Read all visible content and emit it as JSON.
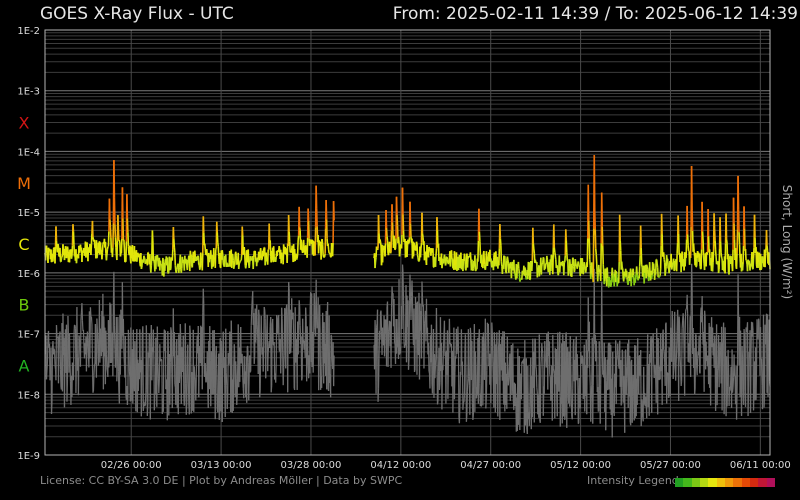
{
  "header": {
    "title": "GOES X-Ray Flux - UTC",
    "range_label": "From: 2025-02-11 14:39  /  To: 2025-06-12 14:39"
  },
  "footer": {
    "license": "License: CC BY-SA 3.0 DE | Plot by Andreas Möller | Data by SWPC",
    "legend_label": "Intensity Legend"
  },
  "legend_colors": [
    "#22a022",
    "#44b81c",
    "#7cc816",
    "#b4d812",
    "#e6e60e",
    "#f0c00c",
    "#f09a0a",
    "#ec7208",
    "#e44a06",
    "#d42a10",
    "#c01636",
    "#b0105a"
  ],
  "chart_data": {
    "type": "line",
    "title": "GOES X-Ray Flux - UTC",
    "ylabel": "Short, Long (W/m²)",
    "yscale": "log",
    "ylim": [
      1e-09,
      0.01
    ],
    "y_ticks": [
      "1E-9",
      "1E-8",
      "1E-7",
      "1E-6",
      "1E-5",
      "1E-4",
      "1E-3",
      "1E-2"
    ],
    "xlim": [
      "2025-02-11 14:39",
      "2025-06-12 14:39"
    ],
    "x_ticks": [
      {
        "date": "2025-02-26 00:00",
        "label": "02/26 00:00"
      },
      {
        "date": "2025-03-13 00:00",
        "label": "03/13 00:00"
      },
      {
        "date": "2025-03-28 00:00",
        "label": "03/28 00:00"
      },
      {
        "date": "2025-04-12 00:00",
        "label": "04/12 00:00"
      },
      {
        "date": "2025-04-27 00:00",
        "label": "04/27 00:00"
      },
      {
        "date": "2025-05-12 00:00",
        "label": "05/12 00:00"
      },
      {
        "date": "2025-05-27 00:00",
        "label": "05/27 00:00"
      },
      {
        "date": "2025-06-11 00:00",
        "label": "06/11 00:00"
      }
    ],
    "flare_classes": [
      {
        "label": "A",
        "flux": 3e-08,
        "color": "#22b422"
      },
      {
        "label": "B",
        "flux": 3e-07,
        "color": "#6cc80c"
      },
      {
        "label": "C",
        "flux": 3e-06,
        "color": "#e6e60a"
      },
      {
        "label": "M",
        "flux": 3e-05,
        "color": "#ee6e08"
      },
      {
        "label": "X",
        "flux": 0.0003,
        "color": "#d21414"
      }
    ],
    "grid": true,
    "series": [
      {
        "key": "long",
        "baseline": [
          [
            "2025-02-11 14:39",
            1.8e-06
          ],
          [
            "2025-02-16 00:00",
            2e-06
          ],
          [
            "2025-02-21 00:00",
            2.4e-06
          ],
          [
            "2025-02-26 00:00",
            1.9e-06
          ],
          [
            "2025-03-03 00:00",
            1.2e-06
          ],
          [
            "2025-03-08 00:00",
            1.5e-06
          ],
          [
            "2025-03-13 00:00",
            1.7e-06
          ],
          [
            "2025-03-18 00:00",
            1.6e-06
          ],
          [
            "2025-03-23 00:00",
            1.9e-06
          ],
          [
            "2025-03-28 00:00",
            2.6e-06
          ],
          [
            "2025-04-02 00:00",
            1.9e-06
          ],
          [
            "2025-04-07 00:00",
            1.6e-06
          ],
          [
            "2025-04-12 00:00",
            2.6e-06
          ],
          [
            "2025-04-17 00:00",
            1.8e-06
          ],
          [
            "2025-04-22 00:00",
            1.5e-06
          ],
          [
            "2025-04-27 00:00",
            1.6e-06
          ],
          [
            "2025-05-02 00:00",
            1e-06
          ],
          [
            "2025-05-07 00:00",
            1.3e-06
          ],
          [
            "2025-05-12 00:00",
            1.2e-06
          ],
          [
            "2025-05-17 00:00",
            8e-07
          ],
          [
            "2025-05-22 00:00",
            8.5e-07
          ],
          [
            "2025-05-27 00:00",
            1.4e-06
          ],
          [
            "2025-06-01 00:00",
            1.6e-06
          ],
          [
            "2025-06-06 00:00",
            1.3e-06
          ],
          [
            "2025-06-12 14:39",
            1.6e-06
          ]
        ],
        "flares": [
          [
            "2025-02-13 10:00",
            7e-06
          ],
          [
            "2025-02-16 06:00",
            8e-06
          ],
          [
            "2025-02-19 12:00",
            9e-06
          ],
          [
            "2025-02-22 08:00",
            2.5e-05
          ],
          [
            "2025-02-23 02:00",
            0.00015
          ],
          [
            "2025-02-23 18:00",
            1.1e-05
          ],
          [
            "2025-02-24 12:00",
            4e-05
          ],
          [
            "2025-02-25 06:00",
            3e-05
          ],
          [
            "2025-03-01 12:00",
            6e-06
          ],
          [
            "2025-03-05 00:00",
            8e-06
          ],
          [
            "2025-03-10 00:00",
            1.1e-05
          ],
          [
            "2025-03-12 06:00",
            9e-06
          ],
          [
            "2025-03-16 12:00",
            8e-06
          ],
          [
            "2025-03-21 00:00",
            9e-06
          ],
          [
            "2025-03-24 06:00",
            1.3e-05
          ],
          [
            "2025-03-26 00:00",
            1.6e-05
          ],
          [
            "2025-03-27 12:00",
            1.6e-05
          ],
          [
            "2025-03-28 20:00",
            4.5e-05
          ],
          [
            "2025-03-30 12:00",
            2.4e-05
          ],
          [
            "2025-03-31 18:00",
            2.2e-05
          ],
          [
            "2025-04-08 06:00",
            1.2e-05
          ],
          [
            "2025-04-09 12:00",
            1.4e-05
          ],
          [
            "2025-04-10 12:00",
            1.8e-05
          ],
          [
            "2025-04-11 06:00",
            2.6e-05
          ],
          [
            "2025-04-12 06:00",
            4e-05
          ],
          [
            "2025-04-13 12:00",
            2.2e-05
          ],
          [
            "2025-04-15 12:00",
            1.3e-05
          ],
          [
            "2025-04-18 00:00",
            1.2e-05
          ],
          [
            "2025-04-25 00:00",
            1.6e-05
          ],
          [
            "2025-04-28 12:00",
            9e-06
          ],
          [
            "2025-05-04 00:00",
            7e-06
          ],
          [
            "2025-05-07 12:00",
            8e-06
          ],
          [
            "2025-05-09 12:00",
            7e-06
          ],
          [
            "2025-05-13 06:00",
            5.5e-05
          ],
          [
            "2025-05-14 06:00",
            0.00022
          ],
          [
            "2025-05-15 12:00",
            4e-05
          ],
          [
            "2025-05-18 12:00",
            1.5e-05
          ],
          [
            "2025-05-22 00:00",
            9e-06
          ],
          [
            "2025-05-25 12:00",
            1.5e-05
          ],
          [
            "2025-05-28 06:00",
            1.3e-05
          ],
          [
            "2025-05-29 18:00",
            1.8e-05
          ],
          [
            "2025-05-30 12:00",
            0.00012
          ],
          [
            "2025-06-01 06:00",
            2.2e-05
          ],
          [
            "2025-06-02 06:00",
            1.6e-05
          ],
          [
            "2025-06-03 06:00",
            1.5e-05
          ],
          [
            "2025-06-04 06:00",
            1.2e-05
          ],
          [
            "2025-06-05 06:00",
            1.3e-05
          ],
          [
            "2025-06-06 12:00",
            2.7e-05
          ],
          [
            "2025-06-07 06:00",
            7.5e-05
          ],
          [
            "2025-06-08 06:00",
            2e-05
          ],
          [
            "2025-06-10 00:00",
            1.2e-05
          ],
          [
            "2025-06-12 00:00",
            6e-06
          ]
        ],
        "gaps": [
          [
            "2025-03-31 22:00",
            "2025-04-07 12:00"
          ]
        ]
      },
      {
        "key": "short",
        "baseline": [
          [
            "2025-02-11 14:39",
            2.5e-08
          ],
          [
            "2025-02-16 00:00",
            4e-08
          ],
          [
            "2025-02-21 00:00",
            8e-08
          ],
          [
            "2025-02-26 00:00",
            3e-08
          ],
          [
            "2025-03-03 00:00",
            2e-08
          ],
          [
            "2025-03-08 00:00",
            3e-08
          ],
          [
            "2025-03-13 00:00",
            2e-08
          ],
          [
            "2025-03-18 00:00",
            5e-08
          ],
          [
            "2025-03-23 00:00",
            6e-08
          ],
          [
            "2025-03-28 00:00",
            8e-08
          ],
          [
            "2025-04-02 00:00",
            4e-08
          ],
          [
            "2025-04-07 00:00",
            3e-08
          ],
          [
            "2025-04-12 00:00",
            2e-07
          ],
          [
            "2025-04-17 00:00",
            5e-08
          ],
          [
            "2025-04-22 00:00",
            2e-08
          ],
          [
            "2025-04-27 00:00",
            3e-08
          ],
          [
            "2025-05-02 00:00",
            1.2e-08
          ],
          [
            "2025-05-07 00:00",
            2e-08
          ],
          [
            "2025-05-12 00:00",
            1.5e-08
          ],
          [
            "2025-05-17 00:00",
            1.2e-08
          ],
          [
            "2025-05-22 00:00",
            1.5e-08
          ],
          [
            "2025-05-27 00:00",
            4e-08
          ],
          [
            "2025-06-01 00:00",
            5e-08
          ],
          [
            "2025-06-06 00:00",
            2e-08
          ],
          [
            "2025-06-12 14:39",
            4e-08
          ]
        ],
        "flares": [
          [
            "2025-02-23 02:00",
            2e-06
          ],
          [
            "2025-02-24 12:00",
            1e-06
          ],
          [
            "2025-03-05 00:00",
            5e-07
          ],
          [
            "2025-03-10 00:00",
            8e-07
          ],
          [
            "2025-03-18 06:00",
            1e-06
          ],
          [
            "2025-03-24 06:00",
            1.3e-06
          ],
          [
            "2025-03-26 00:00",
            6e-07
          ],
          [
            "2025-03-28 20:00",
            1.5e-06
          ],
          [
            "2025-04-10 12:00",
            1.2e-06
          ],
          [
            "2025-04-12 06:00",
            2e-06
          ],
          [
            "2025-04-13 12:00",
            1.5e-06
          ],
          [
            "2025-04-15 12:00",
            8e-07
          ],
          [
            "2025-05-13 06:00",
            9e-07
          ],
          [
            "2025-05-14 06:00",
            2.5e-06
          ],
          [
            "2025-05-15 12:00",
            1.2e-06
          ],
          [
            "2025-05-29 18:00",
            9e-07
          ],
          [
            "2025-05-30 12:00",
            2e-06
          ],
          [
            "2025-06-01 06:00",
            7e-07
          ],
          [
            "2025-06-07 06:00",
            1.5e-06
          ]
        ],
        "gaps": [
          [
            "2025-03-31 22:00",
            "2025-04-07 12:00"
          ]
        ]
      }
    ]
  }
}
